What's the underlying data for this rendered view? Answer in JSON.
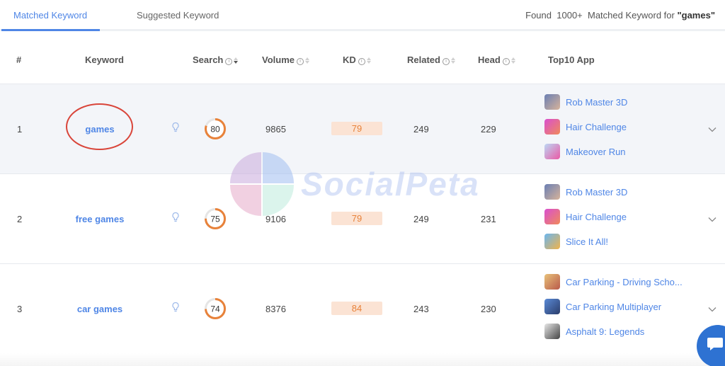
{
  "tabs": [
    {
      "label": "Matched Keyword",
      "active": true
    },
    {
      "label": "Suggested Keyword",
      "active": false
    }
  ],
  "found": {
    "prefix": "Found",
    "count": "1000+",
    "middle": "Matched Keyword for",
    "query": "\"games\""
  },
  "columns": {
    "num": "#",
    "keyword": "Keyword",
    "search": "Search",
    "volume": "Volume",
    "kd": "KD",
    "related": "Related",
    "head": "Head",
    "top10": "Top10 App"
  },
  "rows": [
    {
      "num": "1",
      "keyword": "games",
      "search": "80",
      "volume": "9865",
      "kd": "79",
      "related": "249",
      "head": "229",
      "apps": [
        "Rob Master 3D",
        "Hair Challenge",
        "Makeover Run"
      ]
    },
    {
      "num": "2",
      "keyword": "free games",
      "search": "75",
      "volume": "9106",
      "kd": "79",
      "related": "249",
      "head": "231",
      "apps": [
        "Rob Master 3D",
        "Hair Challenge",
        "Slice It All!"
      ]
    },
    {
      "num": "3",
      "keyword": "car games",
      "search": "74",
      "volume": "8376",
      "kd": "84",
      "related": "243",
      "head": "230",
      "apps": [
        "Car Parking - Driving Scho...",
        "Car Parking Multiplayer",
        "Asphalt 9: Legends"
      ]
    }
  ],
  "watermark": "SocialPeta",
  "colors": {
    "accent": "#4f86e6",
    "ring": "#e8823a",
    "kd_bg": "#fbe3d4",
    "annotation": "#d9453a"
  },
  "icons": {
    "info": "info-circle-icon",
    "sort": "sort-icon",
    "bulb": "lightbulb-icon",
    "expand": "chevron-down-icon",
    "chat": "chat-icon"
  }
}
